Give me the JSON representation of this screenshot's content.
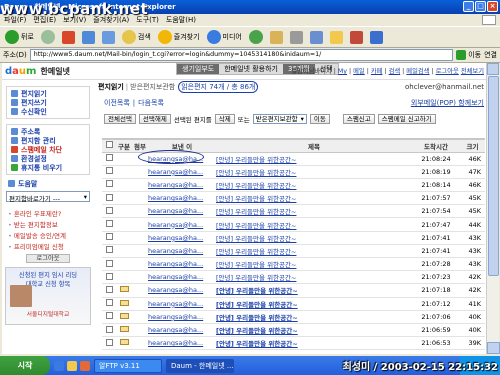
{
  "window": {
    "title": "Daum - 한메일넷 - Microsoft Internet Explorer",
    "watermark": "www.bcpank.net",
    "controls": [
      "_",
      "□",
      "×"
    ]
  },
  "menubar": {
    "items": [
      "파일(F)",
      "편집(E)",
      "보기(V)",
      "즐겨찾기(A)",
      "도구(T)",
      "도움말(H)"
    ]
  },
  "toolbar": {
    "back": "뒤로",
    "search": "검색",
    "favorites": "즐겨찾기",
    "media": "미디어"
  },
  "addressbar": {
    "label": "주소(D)",
    "url": "http://www5.daum.net/Mail-bin/login_t.cgi?error=login&dummy=1045314180&inidaum=1/",
    "go": "이동",
    "links": "연결"
  },
  "daum": {
    "logo": [
      "d",
      "a",
      "u",
      "m"
    ],
    "service": "한메일넷",
    "tabs": [
      "생기일부도",
      "한메일넷 활용하기",
      "36개월",
      "선택"
    ],
    "header_links": [
      "철망이님바이지",
      "My",
      "메일",
      "카페",
      "검색",
      "메일검색",
      "로그아웃",
      "전체보기"
    ]
  },
  "sidebar": {
    "group1": [
      "편지읽기",
      "편지쓰기",
      "수신확인"
    ],
    "group2": [
      "주소록",
      "편지함 관리",
      "스팸메일 차단",
      "환경설정",
      "휴지통 비우기"
    ],
    "folders_label": "도움말",
    "folder_select": "편지함바로가기 ---",
    "links": [
      "혼라인 우표제란?",
      "받는 편지함정보",
      "메일발송 승인/연계",
      "프리미엄메일 신청"
    ],
    "button": "로그아웃",
    "banner": {
      "line1": "신청된 편지 임시 리딩",
      "line2": "대학교 신청 항목",
      "sub": "서울디지털대학교"
    }
  },
  "main": {
    "folder_title": "편지읽기",
    "folder_sub": "받은편지보관함",
    "counts": "읽은편지 74개 / 총 86개",
    "email": "ohclever@hanmail.net",
    "nav": [
      "이전목록",
      "다음목록"
    ],
    "pop_link": "외부메일(POP) 함께보기",
    "actions": {
      "select_all": "전체선택",
      "deselect": "선택해제",
      "selected_msgs": "선택된 편지를",
      "delete": "삭제",
      "or": "또는",
      "move_target": "받은편지보관함",
      "move": "이동",
      "spam_report": "스팸신고",
      "spam_block": "스팸메일 신고하기"
    },
    "columns": [
      "",
      "구분",
      "첨부",
      "보낸 이",
      "제목",
      "도착시간",
      "크기"
    ],
    "rows": [
      {
        "sender": "hearangsa@ha...",
        "subject": "[안녕] 우리들만을 위한공간~",
        "time": "21:08:24",
        "size": "46K",
        "bold": false,
        "attach": false
      },
      {
        "sender": "hearangsa@ha...",
        "subject": "[안녕] 우리들만을 위한공간~",
        "time": "21:08:19",
        "size": "47K",
        "bold": false,
        "attach": false
      },
      {
        "sender": "hearangsa@ha...",
        "subject": "[안녕] 우리들만을 위한공간~",
        "time": "21:08:14",
        "size": "46K",
        "bold": false,
        "attach": false
      },
      {
        "sender": "hearangsa@ha...",
        "subject": "[안녕] 우리들만을 위한공간~",
        "time": "21:07:57",
        "size": "45K",
        "bold": false,
        "attach": false
      },
      {
        "sender": "hearangsa@ha...",
        "subject": "[안녕] 우리들만을 위한공간~",
        "time": "21:07:54",
        "size": "45K",
        "bold": false,
        "attach": false
      },
      {
        "sender": "hearangsa@ha...",
        "subject": "[안녕] 우리들만을 위한공간~",
        "time": "21:07:47",
        "size": "44K",
        "bold": false,
        "attach": false
      },
      {
        "sender": "hearangsa@ha...",
        "subject": "[안녕] 우리들만을 위한공간~",
        "time": "21:07:41",
        "size": "43K",
        "bold": false,
        "attach": false
      },
      {
        "sender": "hearangsa@ha...",
        "subject": "[안녕] 우리들만을 위한공간~",
        "time": "21:07:41",
        "size": "43K",
        "bold": false,
        "attach": false
      },
      {
        "sender": "hearangsa@ha...",
        "subject": "[안녕] 우리들만을 위한공간~",
        "time": "21:07:28",
        "size": "43K",
        "bold": false,
        "attach": false
      },
      {
        "sender": "hearangsa@ha...",
        "subject": "[안녕] 우리들만을 위한공간~",
        "time": "21:07:23",
        "size": "42K",
        "bold": false,
        "attach": false
      },
      {
        "sender": "hearangsa@ha...",
        "subject": "[안녕] 우리들만을 위한공간~",
        "time": "21:07:18",
        "size": "42K",
        "bold": true,
        "attach": true
      },
      {
        "sender": "hearangsa@ha...",
        "subject": "[안녕] 우리들만을 위한공간~",
        "time": "21:07:12",
        "size": "41K",
        "bold": true,
        "attach": true
      },
      {
        "sender": "hearangsa@ha...",
        "subject": "[안녕] 우리들만을 위한공간~",
        "time": "21:07:06",
        "size": "40K",
        "bold": true,
        "attach": true
      },
      {
        "sender": "hearangsa@ha...",
        "subject": "[안녕] 우리들만을 위한공간~",
        "time": "21:06:59",
        "size": "40K",
        "bold": true,
        "attach": true
      },
      {
        "sender": "hearangsa@ha...",
        "subject": "[안녕] 우리들만을 위한공간~",
        "time": "21:06:53",
        "size": "39K",
        "bold": true,
        "attach": true
      }
    ]
  },
  "taskbar": {
    "start": "시작",
    "tasks": [
      "알FTP v3.11",
      "Daum - 한메일넷 ..."
    ]
  },
  "stamp": "최성미 / 2003-02-15 22:15:32",
  "colors": {
    "accent": "#1a3fa8",
    "red": "#c4261d",
    "titlebar": "#0a5fd8"
  }
}
